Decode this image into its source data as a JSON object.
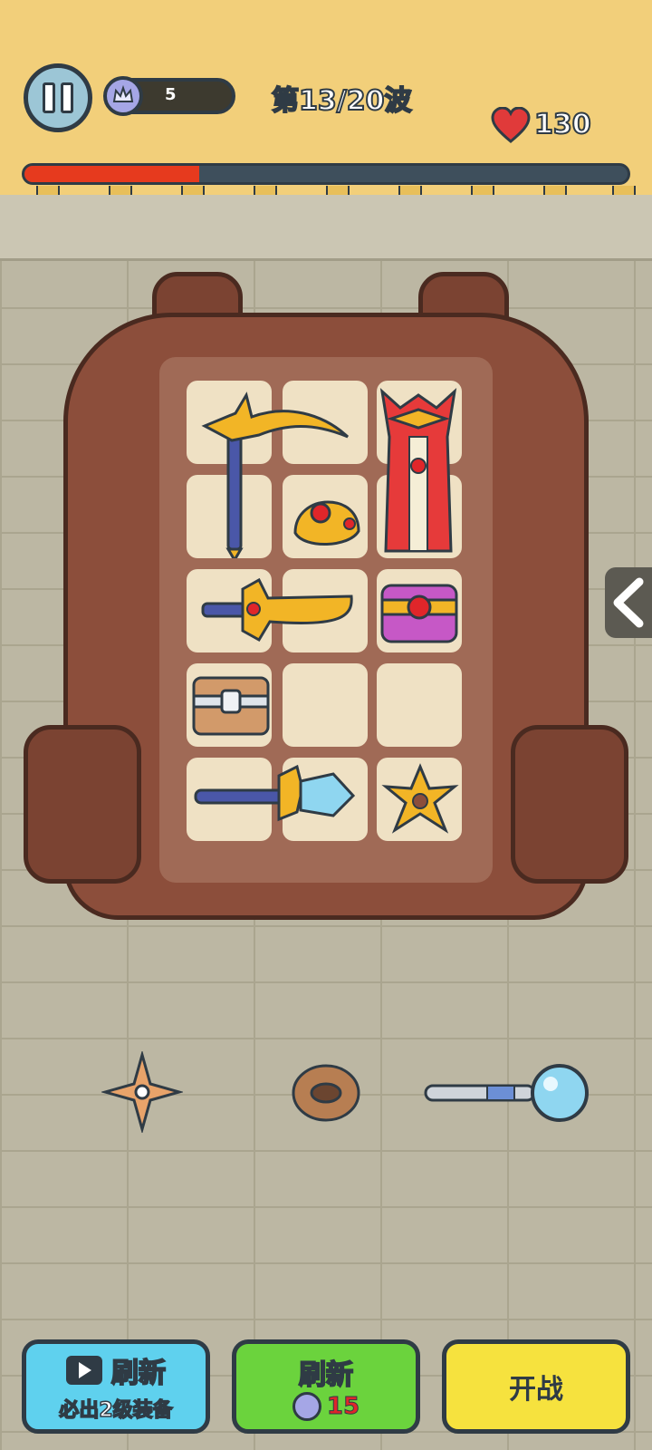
{
  "hud": {
    "coins": "5",
    "wave": "第13/20波",
    "hp": "130",
    "wave_progress": 0.29
  },
  "backpack": {
    "grid": {
      "cols": 3,
      "rows": 5
    },
    "items": [
      {
        "name": "golden-scythe",
        "slot": "r1c1-r2c2"
      },
      {
        "name": "golden-crown",
        "slot": "r2c2"
      },
      {
        "name": "royal-cape",
        "slot": "r1c3-r2c3"
      },
      {
        "name": "golden-sword",
        "slot": "r3c1-r3c2"
      },
      {
        "name": "treasure-chest-pink",
        "slot": "r3c3"
      },
      {
        "name": "wooden-chest",
        "slot": "r4c1"
      },
      {
        "name": "crystal-wand",
        "slot": "r5c1-r5c2"
      },
      {
        "name": "golden-shuriken",
        "slot": "r5c3"
      }
    ]
  },
  "shop": {
    "items": [
      "shuriken",
      "wooden-ring",
      "blue-orb-staff"
    ]
  },
  "buttons": {
    "ad_refresh_label": "刷新",
    "ad_refresh_sub": "必出2级装备",
    "refresh_label": "刷新",
    "refresh_cost": "15",
    "start_label": "开战"
  },
  "colors": {
    "topbar": "#f2cf7a",
    "hp_bar": "#e63a1e",
    "button_blue": "#5fd1ee",
    "button_green": "#6bd33d",
    "button_yellow": "#f6e23e"
  }
}
